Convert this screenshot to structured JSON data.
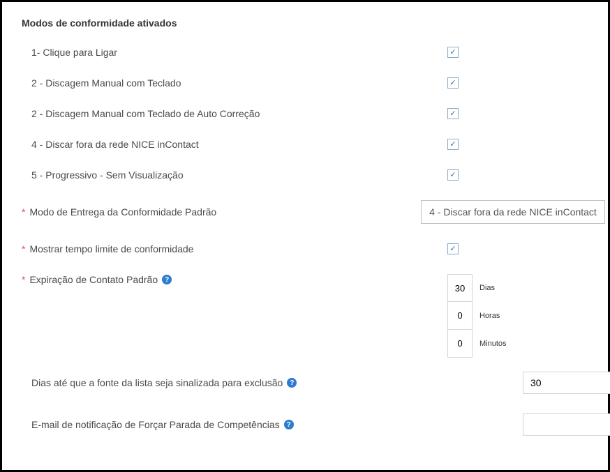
{
  "section_title": "Modos de conformidade ativados",
  "modes": [
    {
      "label": "1- Clique para Ligar",
      "checked": true
    },
    {
      "label": "2 - Discagem Manual com Teclado",
      "checked": true
    },
    {
      "label": "2 - Discagem Manual com Teclado de Auto Correção",
      "checked": true
    },
    {
      "label": "4 - Discar fora da rede NICE inContact",
      "checked": true
    },
    {
      "label": "5 - Progressivo - Sem Visualização",
      "checked": true
    }
  ],
  "delivery_mode": {
    "label": "Modo de Entrega da Conformidade Padrão",
    "value": "4 - Discar fora da rede NICE inContact"
  },
  "show_timeout": {
    "label": "Mostrar tempo limite de conformidade",
    "checked": true
  },
  "expiration": {
    "label": "Expiração de Contato Padrão",
    "days": {
      "value": "30",
      "unit": "Dias"
    },
    "hours": {
      "value": "0",
      "unit": "Horas"
    },
    "minutes": {
      "value": "0",
      "unit": "Minutos"
    }
  },
  "days_until_flag": {
    "label": "Dias até que a fonte da lista seja sinalizada para exclusão",
    "value": "30"
  },
  "force_stop_email": {
    "label": "E-mail de notificação de Forçar Parada de Competências",
    "value": ""
  }
}
